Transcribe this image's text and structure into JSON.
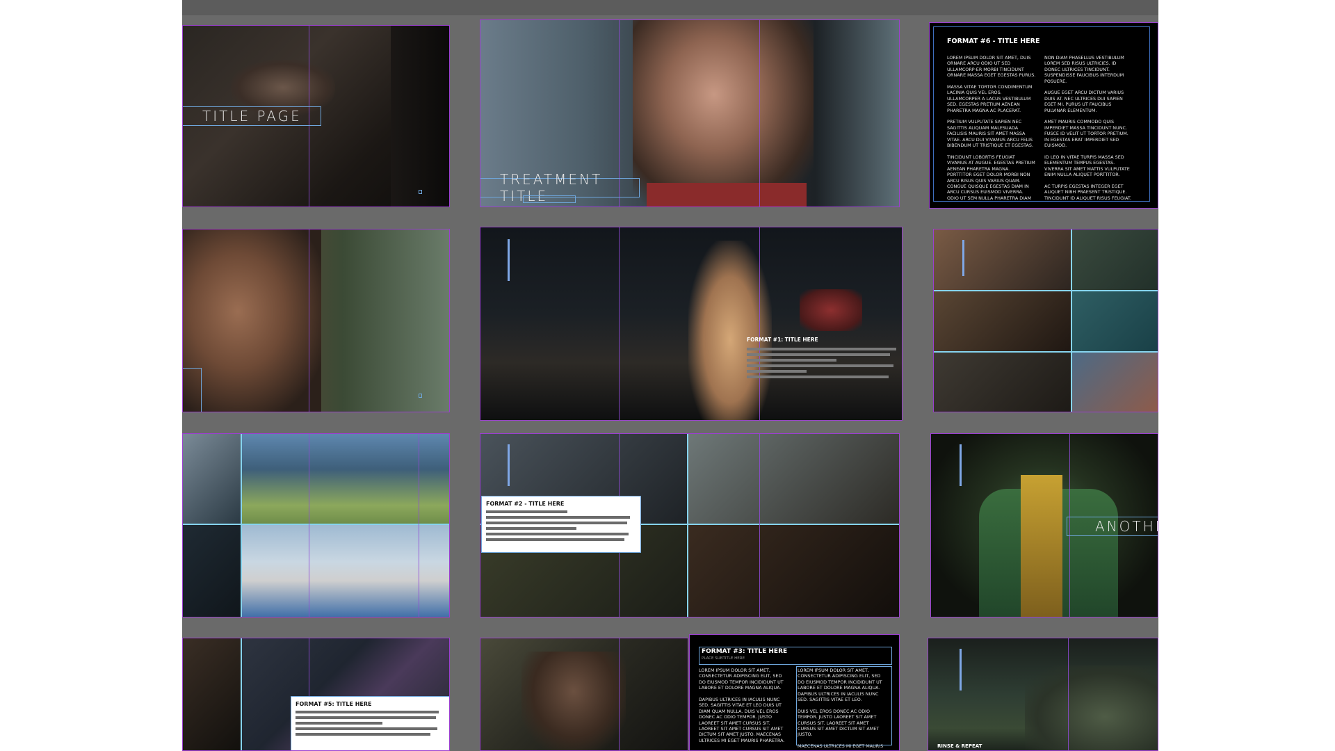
{
  "colors": {
    "canvas": "#6a6a6a",
    "frame": "#9b3fd0",
    "guide": "#7fc9e6",
    "textbox_border": "#6fa7dd"
  },
  "slides": {
    "title_page": {
      "title": "TITLE PAGE"
    },
    "treatment": {
      "title": "TREATMENT TITLE"
    },
    "format6": {
      "title": "FORMAT #6 - TITLE HERE",
      "col1": "LOREM IPSUM DOLOR SIT AMET, DUIS ORNARE ARCU ODIO UT SED ULLAMCORP-ER MORBI TINCIDUNT ORNARE MASSA EGET EGESTAS PURUS.\n\nMASSA VITAE TORTOR CONDIMENTUM LACINIA QUIS VEL EROS. ULLAMCORPER A LACUS VESTIBULUM SED. EGESTAS PRETIUM AENEAN PHARETRA MAGNA AC PLACERAT.\n\nPRETIUM VULPUTATE SAPIEN NEC SAGITTIS ALIQUAM MALESUADA FACILISIS MAURIS SIT AMET MASSA VITAE. ARCU DUI VIVAMUS ARCU FELIS BIBENDUM UT TRISTIQUE ET EGESTAS.\n\nTINCIDUNT LOBORTIS FEUGIAT VIVAMUS AT AUGUE. EGESTAS PRETIUM AENEAN PHARETRA MAGNA. PORTTITOR EGET DOLOR MORBI NON ARCU RISUS QUIS VARIUS QUAM. CONGUE QUISQUE EGESTAS DIAM IN ARCU CURSUS EUISMOD VIVERRA. ODIO UT SEM NULLA PHARETRA DIAM SIT AMET NISL. VEHICULA IPSUM A ARCU CURSUS VITAE.\n\nVIVERRA ALIQUET EGET SIT AMET TELLUS CRAS ADIPISCING.",
      "col2": "NON DIAM PHASELLUS VESTIBULUM LOREM SED RISUS ULTRICIES. ID DONEC ULTRICES TINCIDUNT. SUSPENDISSE FAUCIBUS INTERDUM POSUERE.\n\nAUGUE EGET ARCU DICTUM VARIUS DUIS AT. NEC ULTRICES DUI SAPIEN EGET MI. PURUS UT FAUCIBUS PULVINAR ELEMENTUM.\n\nAMET MAURIS COMMODO QUIS IMPERDIET MASSA TINCIDUNT NUNC. FUSCE ID VELIT UT TORTOR PRETIUM. IN EGESTAS ERAT IMPERDIET SED EUISMOD.\n\nID LEO IN VITAE TURPIS MASSA SED ELEMENTUM TEMPUS EGESTAS. VIVERRA SIT AMET MATTIS VULPUTATE ENIM NULLA ALIQUET PORTTITOR.\n\nAC TURPIS EGESTAS INTEGER EGET ALIQUET NIBH PRAESENT TRISTIQUE. TINCIDUNT ID ALIQUET RISUS FEUGIAT. BLANDIT CURSUS RISUS AT ULTRICES MI TEMPUS.\n\nMAECENAS SED ENIM UT SEM."
    },
    "format1": {
      "title": "FORMAT #1: TITLE HERE"
    },
    "format2": {
      "title": "FORMAT #2 - TITLE HERE"
    },
    "another": {
      "title": "ANOTHER"
    },
    "format5": {
      "title": "FORMAT #5: TITLE HERE"
    },
    "format3": {
      "title": "FORMAT #3: TITLE HERE",
      "subtitle": "PLACE SUBTITLE HERE",
      "col1": "LOREM IPSUM DOLOR SIT AMET, CONSECTETUR ADIPISCING ELIT, SED DO EIUSMOD TEMPOR INCIDIDUNT UT LABORE ET DOLORE MAGNA ALIQUA.\n\nDAPIBUS ULTRICES IN IACULIS NUNC SED. SAGITTIS VITAE ET LEO DUIS UT DIAM QUAM NULLA. DUIS VEL EROS DONEC AC ODIO TEMPOR. JUSTO LAOREET SIT AMET CURSUS SIT. LAOREET SIT AMET CURSUS SIT AMET DICTUM SIT AMET JUSTO. MAECENAS ULTRICES MI EGET MAURIS PHARETRA.\n\nDUIS TRISTIQUE SOLLICITUDIN NIBH SIT.\n\nFELIS EGET VELIT ALIQUET SAGITTIS ID CONSECTETUR PURUS UT. SIT AMET EGET GRAVIDA",
      "col2": "LOREM IPSUM DOLOR SIT AMET, CONSECTETUR ADIPISCING ELIT, SED DO EIUSMOD TEMPOR INCIDIDUNT UT LABORE ET DOLORE MAGNA ALIQUA. DAPIBUS ULTRICES IN IACULIS NUNC SED. SAGITTIS VITAE ET LEO.\n\nDUIS VEL EROS DONEC AC ODIO TEMPOR. JUSTO LAOREET SIT AMET CURSUS SIT. LAOREET SIT AMET CURSUS SIT AMET DICTUM SIT AMET JUSTO.\n\nMAECENAS ULTRICES MI EGET MAURIS PHARETRA. DUIS TRISTIQUE SOLLICITUDIN NIBH SIT.\n\nFELIS EGET VELIT ALIQUET SAGITTIS ID CONSE"
    },
    "rinse": {
      "title": "RINSE & REPEAT"
    }
  }
}
